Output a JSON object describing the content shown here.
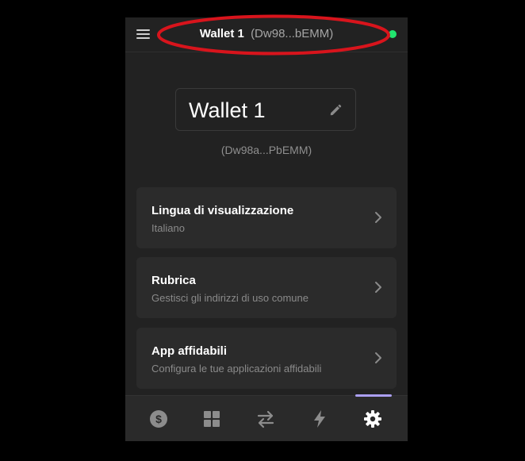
{
  "header": {
    "menu_icon": "hamburger-menu-icon",
    "wallet_name": "Wallet 1",
    "wallet_address_short": "(Dw98...bEMM)",
    "status_color": "#21e56f"
  },
  "wallet": {
    "name": "Wallet 1",
    "address_short": "(Dw98a...PbEMM)",
    "edit_icon": "pencil-icon"
  },
  "settings": [
    {
      "title": "Lingua di visualizzazione",
      "subtitle": "Italiano"
    },
    {
      "title": "Rubrica",
      "subtitle": "Gestisci gli indirizzi di uso comune"
    },
    {
      "title": "App affidabili",
      "subtitle": "Configura le tue applicazioni affidabili"
    }
  ],
  "nav": {
    "items": [
      "dollar-coin-icon",
      "collectibles-grid-icon",
      "swap-arrows-icon",
      "activity-bolt-icon",
      "settings-gear-icon"
    ],
    "active": "settings-gear-icon",
    "accent": "#ab9ff2"
  },
  "annotation": {
    "color": "#d8141c"
  }
}
